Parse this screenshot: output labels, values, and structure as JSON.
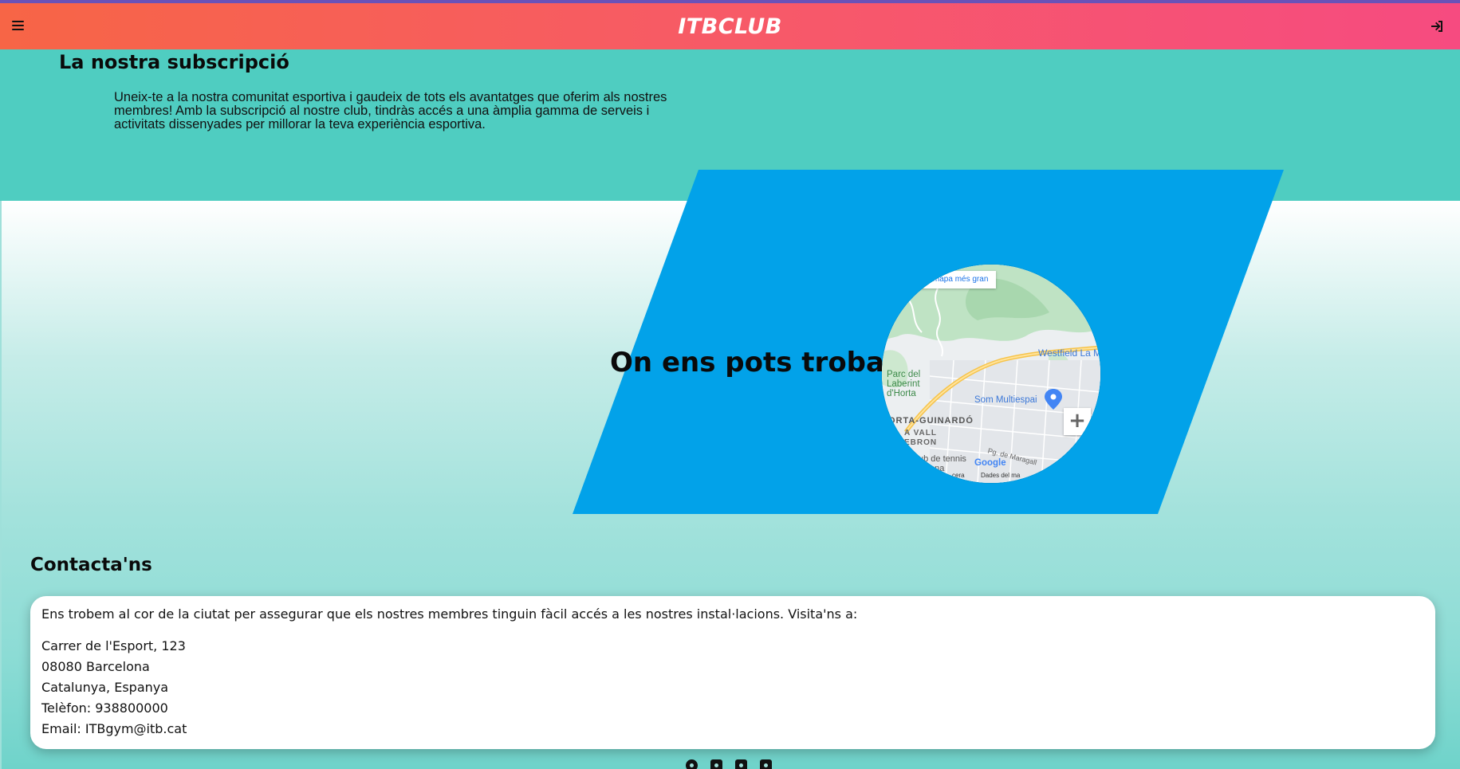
{
  "header": {
    "brand": "ITBCLUB",
    "menu_icon": "hamburger-menu-icon",
    "login_icon": "sign-in-icon"
  },
  "subscription": {
    "title": "La nostra subscripció",
    "text": "Uneix-te a la nostra comunitat esportiva i gaudeix de tots els avantatges que oferim als nostres membres! Amb la subscripció al nostre club, tindràs accés a una àmplia gamma de serveis i activitats dissenyades per millorar la teva experiència esportiva."
  },
  "location": {
    "title": "On ens pots trobar",
    "map": {
      "larger_map_button": "en mapa més gran",
      "labels": {
        "westfield": "Westfield La M",
        "park": "Parc del Laberint d'Horta",
        "park_l1": "Parc del",
        "park_l2": "Laberint",
        "park_l3": "d'Horta",
        "som": "Som Multiespai",
        "district": "ORTA-GUINARDÓ",
        "vall1": "A VALL",
        "vall2": "EBRON",
        "tennis1": "ub de tennis",
        "tennis2": "celona",
        "street": "Pg. de Maragall",
        "google": "Google",
        "data1": "cera",
        "data2": "Dades del ma"
      },
      "zoom_in": "+"
    }
  },
  "contact": {
    "title": "Contacta'ns",
    "intro": "Ens trobem al cor de la ciutat per assegurar que els nostres membres tinguin fàcil accés a les nostres instal·lacions. Visita'ns a:",
    "address_line1": "Carrer de l'Esport, 123",
    "address_line2": "08080 Barcelona",
    "address_line3": "Catalunya, Espanya",
    "phone": "Telèfon: 938800000",
    "email": "Email: ITBgym@itb.cat"
  },
  "footer": {
    "socials": [
      "facebook-icon",
      "instagram-icon",
      "twitter-icon",
      "youtube-icon"
    ]
  },
  "colors": {
    "header_start": "#f76546",
    "header_end": "#f64b80",
    "teal": "#4fcdc1",
    "blue": "#02a2e9"
  }
}
